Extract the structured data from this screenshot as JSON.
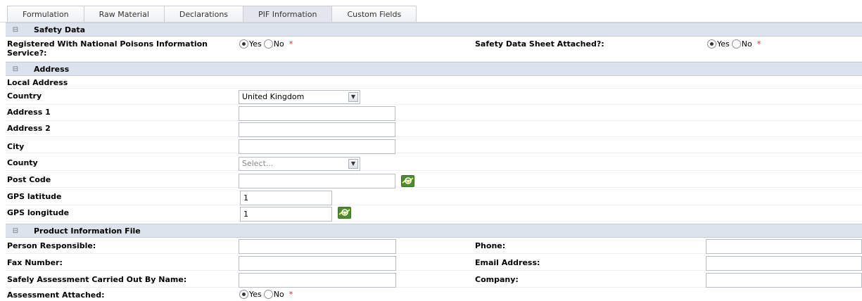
{
  "tabs": [
    "Formulation",
    "Raw Material",
    "Declarations",
    "PIF Information",
    "Custom Fields"
  ],
  "active_tab": "PIF Information",
  "sections": {
    "safety": {
      "title": "Safety Data",
      "toggle": "⊟",
      "npis_label": "Registered With National Poisons Information Service?:",
      "npis_value": "Yes",
      "sds_label": "Safety Data Sheet Attached?:",
      "sds_value": "Yes",
      "yes": "Yes",
      "no": "No",
      "required": "*"
    },
    "address": {
      "title": "Address",
      "toggle": "⊟",
      "local_address": "Local Address",
      "country_label": "Country",
      "country_value": "United Kingdom",
      "address1_label": "Address 1",
      "address1_value": "",
      "address2_label": "Address 2",
      "address2_value": "",
      "city_label": "City",
      "city_value": "",
      "county_label": "County",
      "county_placeholder": "Select...",
      "postcode_label": "Post Code",
      "postcode_value": "",
      "lat_label": "GPS latitude",
      "lat_value": "1",
      "lng_label": "GPS longitude",
      "lng_value": "1"
    },
    "pif": {
      "title": "Product Information File",
      "toggle": "⊟",
      "person_label": "Person Responsible:",
      "phone_label": "Phone:",
      "fax_label": "Fax Number:",
      "email_label": "Email Address:",
      "assessor_label": "Safely Assessment Carried Out By Name:",
      "company_label": "Company:",
      "attached_label": "Assessment Attached:",
      "attached_value": "Yes",
      "yes": "Yes",
      "no": "No",
      "required": "*"
    }
  },
  "colors": {
    "section_bg": "#dde3ec",
    "required": "#e02020",
    "map_icon": "#3d6f2a"
  }
}
